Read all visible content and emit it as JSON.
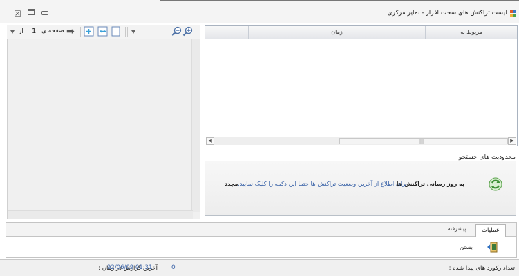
{
  "window": {
    "title": "لیست تراکنش های سخت افزار - نمایر مرکزی"
  },
  "grid": {
    "columns": [
      {
        "key": "related",
        "label": "مربوط به"
      },
      {
        "key": "time",
        "label": "زمان"
      }
    ]
  },
  "viewer": {
    "page_label": "صفحه ی",
    "page_number": "1",
    "page_of": "از"
  },
  "search": {
    "section_label": "محدودیت های جستجو",
    "refresh_label": "به روز رسانی تراکنش ها",
    "refresh_hint": "برای اطلاع از آخرین وضعیت تراکنش ها حتما این دکمه را کلیک نمایید.",
    "refresh_new": "مجدد"
  },
  "tabs": {
    "operations": "عملیات",
    "advanced": "پیشرفته"
  },
  "operations": {
    "close_label": "بستن"
  },
  "status": {
    "count_label": "تعداد رکورد های پیدا شده :",
    "count_value": "0",
    "time_label": "آخرین گزارش در زمان :",
    "time_value": "92/06/09 01:31"
  },
  "colors": {
    "link_blue": "#3a63a8",
    "grid_border": "#a9b3c0",
    "panel_bg": "#f0f0f0"
  },
  "icons": {
    "app": "app-grid-icon",
    "refresh": "refresh-cycle-icon",
    "close": "exit-door-icon",
    "zoom_in": "zoom-in-icon",
    "zoom_out": "zoom-out-icon",
    "next_page": "arrow-right-icon"
  }
}
